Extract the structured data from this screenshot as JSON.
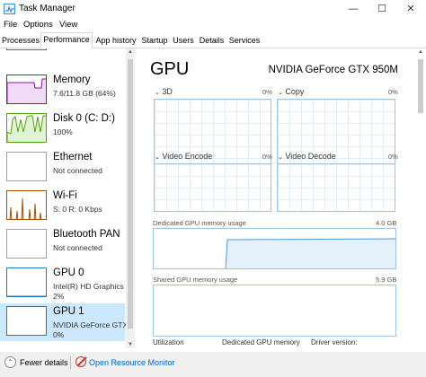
{
  "window": {
    "title": "Task Manager",
    "controls": [
      "—",
      "☐",
      "✕"
    ]
  },
  "menu": [
    "File",
    "Options",
    "View"
  ],
  "tabs": [
    "Processes",
    "Performance",
    "App history",
    "Startup",
    "Users",
    "Details",
    "Services"
  ],
  "active_tab": "Performance",
  "sidebar": {
    "items": [
      {
        "title": "Memory",
        "sub1": "7.6/11.8 GB (64%)",
        "sub2": "",
        "color": "#8b12ae"
      },
      {
        "title": "Disk 0 (C: D:)",
        "sub1": "100%",
        "sub2": "",
        "color": "#4da60c"
      },
      {
        "title": "Ethernet",
        "sub1": "Not connected",
        "sub2": "",
        "color": "#a0a0a0"
      },
      {
        "title": "Wi-Fi",
        "sub1": "S: 0 R: 0 Kbps",
        "sub2": "",
        "color": "#a74f01"
      },
      {
        "title": "Bluetooth PAN",
        "sub1": "Not connected",
        "sub2": "",
        "color": "#a0a0a0"
      },
      {
        "title": "GPU 0",
        "sub1": "Intel(R) HD Graphics",
        "sub2": "2%",
        "color": "#1a7bc4"
      },
      {
        "title": "GPU 1",
        "sub1": "NVIDIA GeForce GTX",
        "sub2": "0%",
        "color": "#1a7bc4"
      }
    ],
    "selected": "GPU 1"
  },
  "main": {
    "title": "GPU",
    "gpu_name": "NVIDIA GeForce GTX 950M",
    "engines": [
      {
        "label": "3D",
        "pct": "0%"
      },
      {
        "label": "Copy",
        "pct": "0%"
      },
      {
        "label": "Video Encode",
        "pct": "0%"
      },
      {
        "label": "Video Decode",
        "pct": "0%"
      }
    ],
    "dedicated": {
      "label": "Dedicated GPU memory usage",
      "max": "4.0 GB"
    },
    "shared": {
      "label": "Shared GPU memory usage",
      "max": "5.9 GB"
    },
    "stats": [
      "Utilization",
      "Dedicated GPU memory",
      "Driver version:"
    ]
  },
  "footer": {
    "fewer_details": "Fewer details",
    "open_resource_monitor": "Open Resource Monitor"
  },
  "colors": {
    "accent": "#1a7bc4",
    "graph_border": "#9ec5e3",
    "selected_bg": "#cce8ff",
    "link": "#0066cc"
  }
}
